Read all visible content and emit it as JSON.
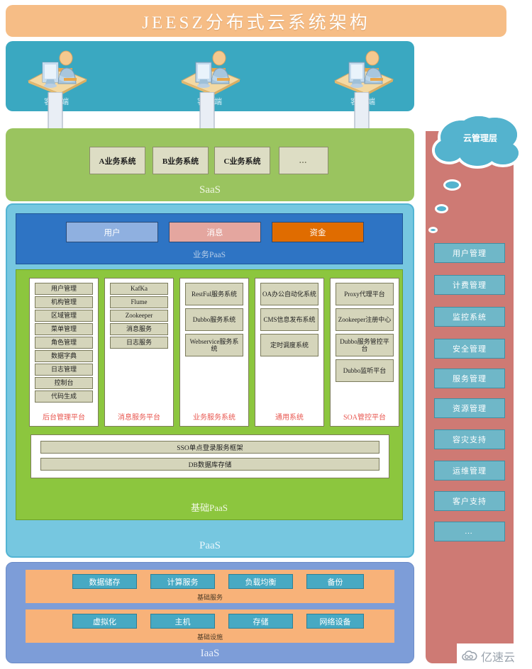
{
  "title": "JEESZ分布式云系统架构",
  "clients": {
    "icon": "user-at-computer-icon",
    "items": [
      {
        "label": "客户端"
      },
      {
        "label": "客户端"
      },
      {
        "label": "客户端"
      }
    ]
  },
  "saas": {
    "label": "SaaS",
    "systems": [
      {
        "label": "A业务系统"
      },
      {
        "label": "B业务系统"
      },
      {
        "label": "C业务系统"
      },
      {
        "label": "…"
      }
    ]
  },
  "paas": {
    "label": "PaaS",
    "business_paas": {
      "label": "业务PaaS",
      "cards": [
        {
          "label": "用户",
          "color": "#8fb0e0"
        },
        {
          "label": "消息",
          "color": "#e4a69f"
        },
        {
          "label": "资金",
          "color": "#e06c00"
        }
      ]
    },
    "base_paas": {
      "label": "基础PaaS",
      "columns": [
        {
          "title": "后台管理平台",
          "items": [
            "用户管理",
            "机构管理",
            "区域管理",
            "菜单管理",
            "角色管理",
            "数据字典",
            "日志管理",
            "控制台",
            "代码生成"
          ]
        },
        {
          "title": "消息服务平台",
          "items": [
            "KafKa",
            "Flume",
            "Zookeeper",
            "消息服务",
            "日志服务"
          ]
        },
        {
          "title": "业务服务系统",
          "items": [
            "RestFul服务系统",
            "Dubbo服务系统",
            "Webservice服务系统"
          ]
        },
        {
          "title": "通用系统",
          "items": [
            "OA办公自动化系统",
            "CMS信息发布系统",
            "定时调度系统"
          ]
        },
        {
          "title": "SOA管控平台",
          "items": [
            "Proxy代理平台",
            "Zookeeper注册中心",
            "Dubbo服务管控平台",
            "Dubbo监听平台"
          ]
        }
      ],
      "shared": [
        {
          "label": "SSO单点登录服务框架"
        },
        {
          "label": "DB数据库存储"
        }
      ]
    }
  },
  "iaas": {
    "label": "IaaS",
    "groups": [
      {
        "label": "基础服务",
        "items": [
          "数据储存",
          "计算服务",
          "负载均衡",
          "备份"
        ]
      },
      {
        "label": "基础设施",
        "items": [
          "虚拟化",
          "主机",
          "存储",
          "网络设备"
        ]
      }
    ]
  },
  "cloud_panel": {
    "cloud_label": "云管理层",
    "items": [
      {
        "label": "用户管理"
      },
      {
        "label": "计费管理"
      },
      {
        "label": "监控系统"
      },
      {
        "label": "安全管理"
      },
      {
        "label": "服务管理"
      },
      {
        "label": "资源管理"
      },
      {
        "label": "容灾支持"
      },
      {
        "label": "运维管理"
      },
      {
        "label": "客户支持"
      },
      {
        "label": "…"
      }
    ]
  },
  "watermark": {
    "text": "亿速云",
    "icon": "cloud-logo-icon"
  },
  "colors": {
    "title_bar": "#f6bd86",
    "client_band": "#3aa8c1",
    "saas": "#9ac45f",
    "paas_outer": "#76c7e0",
    "business_paas": "#2e74c4",
    "base_paas": "#8cc63e",
    "iaas_outer": "#7d9dd8",
    "iaas_group": "#f8b279",
    "iaas_chip": "#47a9c3",
    "cloud_panel": "#ce7a74",
    "cloud": "#54b3ce",
    "cloud_item": "#6fb7c8",
    "card": "#d5d5bb",
    "column_title": "#e8564f"
  }
}
